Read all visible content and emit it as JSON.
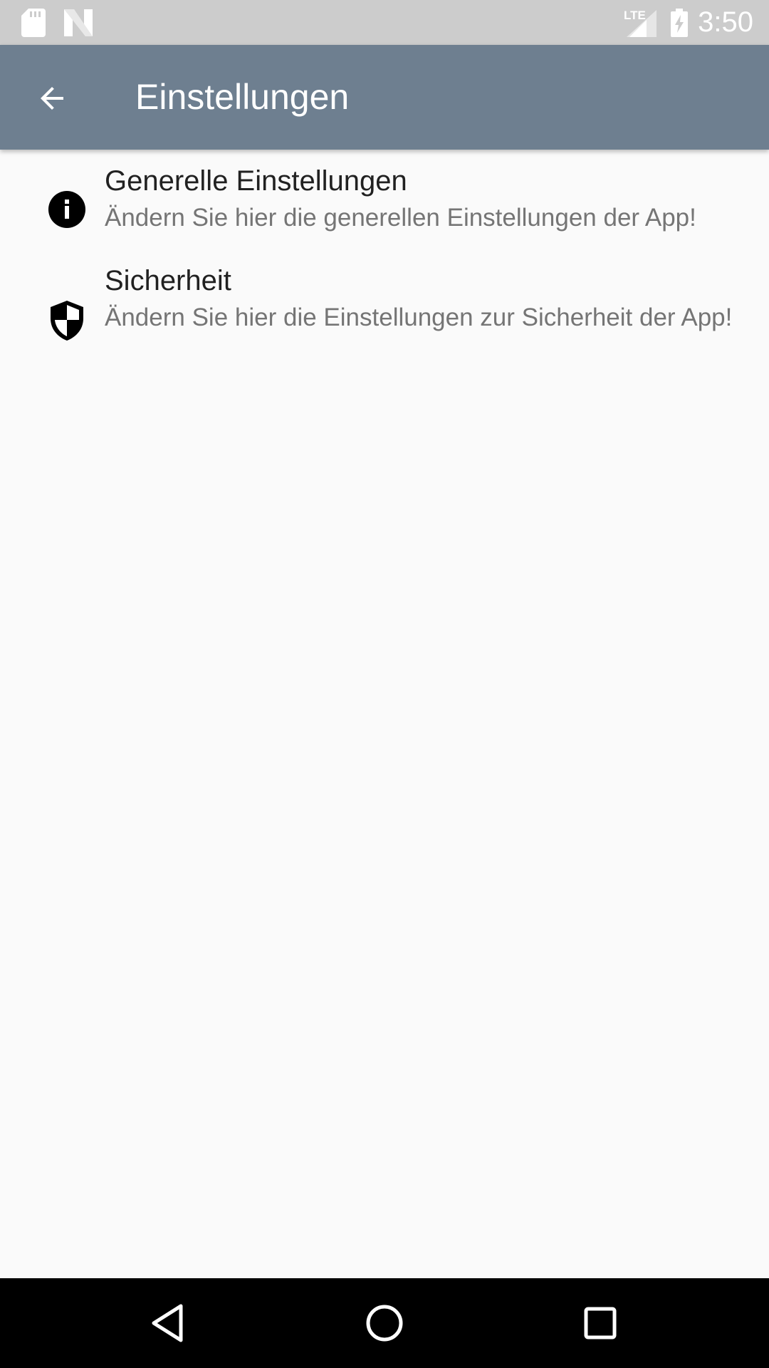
{
  "status_bar": {
    "time": "3:50",
    "network": "LTE",
    "icons": [
      "sd-card-icon",
      "n-logo-icon",
      "lte-signal-icon",
      "battery-charging-icon"
    ]
  },
  "app_bar": {
    "back_icon": "arrow-back-icon",
    "title": "Einstellungen",
    "background": "#6e7f90"
  },
  "preferences": [
    {
      "icon": "info-icon",
      "title": "Generelle Einstellungen",
      "summary": "Ändern Sie hier die generellen Einstellungen der App!"
    },
    {
      "icon": "shield-icon",
      "title": "Sicherheit",
      "summary": "Ändern Sie hier die Einstellungen zur Sicherheit der App!"
    }
  ],
  "nav_bar": {
    "buttons": [
      "back-triangle-icon",
      "home-circle-icon",
      "recents-square-icon"
    ]
  }
}
